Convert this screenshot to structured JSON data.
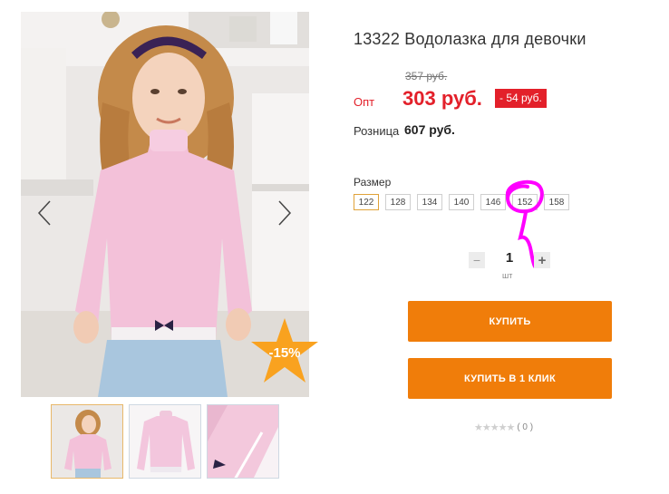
{
  "product": {
    "title": "13322 Водолазка для девочки",
    "old_price": "357 руб.",
    "opt_label": "Опт",
    "opt_price": "303 руб.",
    "discount_amount": "- 54 руб.",
    "retail_label": "Розница",
    "retail_price": "607 руб.",
    "discount_percent": "-15%"
  },
  "gallery": {
    "prev_icon": "chevron-left-icon",
    "next_icon": "chevron-right-icon",
    "thumbnails": [
      "thumb-girl-photo",
      "thumb-turtleneck-front",
      "thumb-turtleneck-detail"
    ],
    "active_thumbnail": 0
  },
  "sizes": {
    "label": "Размер",
    "options": [
      "122",
      "128",
      "134",
      "140",
      "146",
      "152",
      "158"
    ],
    "selected": "122"
  },
  "quantity": {
    "minus": "−",
    "value": "1",
    "plus": "+",
    "unit": "шт"
  },
  "actions": {
    "buy": "КУПИТЬ",
    "one_click": "КУПИТЬ В 1 КЛИК"
  },
  "rating": {
    "stars": "★★★★★",
    "count": "( 0 )"
  },
  "colors": {
    "accent_orange": "#f07d0a",
    "price_red": "#e3202a",
    "annotation_magenta": "#ff00ff"
  }
}
